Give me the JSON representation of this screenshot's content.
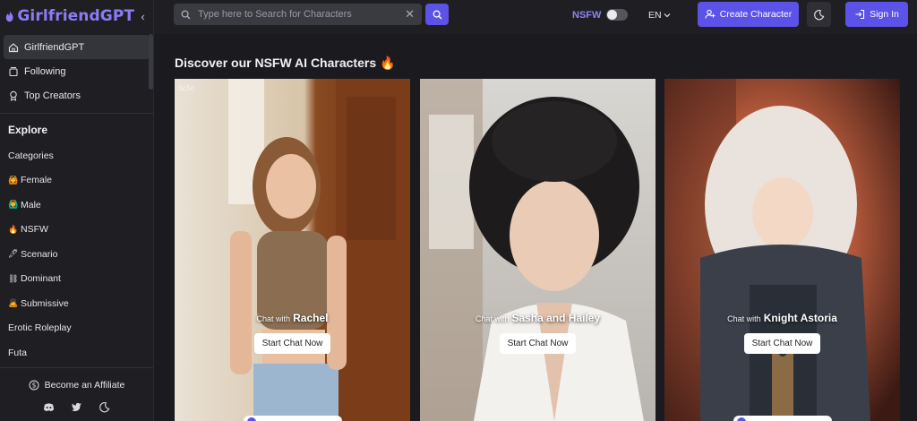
{
  "brand": {
    "name": "GirlfriendGPT",
    "collapse_glyph": "‹"
  },
  "sidebar": {
    "primary": [
      {
        "label": "GirlfriendGPT",
        "icon": "home-icon",
        "active": true
      },
      {
        "label": "Following",
        "icon": "following-icon",
        "active": false
      },
      {
        "label": "Top Creators",
        "icon": "award-icon",
        "active": false
      }
    ],
    "explore_title": "Explore",
    "explore": [
      {
        "label": "Categories",
        "emoji": ""
      },
      {
        "label": "Female",
        "emoji": "🙆"
      },
      {
        "label": "Male",
        "emoji": "🙆‍♂"
      },
      {
        "label": "NSFW",
        "emoji": "🔥"
      },
      {
        "label": "Scenario",
        "emoji": "🖊"
      },
      {
        "label": "Dominant",
        "emoji": "⛓"
      },
      {
        "label": "Submissive",
        "emoji": "🙇"
      },
      {
        "label": "Erotic Roleplay",
        "emoji": ""
      },
      {
        "label": "Futa",
        "emoji": ""
      }
    ],
    "affiliate_label": "Become an Affiliate"
  },
  "topbar": {
    "search_placeholder": "Type here to Search for Characters",
    "nsfw_label": "NSFW",
    "lang_label": "EN",
    "create_label": "Create Character",
    "signin_label": "Sign In"
  },
  "main": {
    "title": "Discover our NSFW AI Characters 🔥",
    "cards": [
      {
        "pre": "Chat with",
        "name": "Rachel",
        "button": "Start Chat Now",
        "watermark": "Sc5o"
      },
      {
        "pre": "Chat with",
        "name": "Sasha and Hailey",
        "button": "Start Chat Now",
        "watermark": ""
      },
      {
        "pre": "Chat with",
        "name": "Knight Astoria",
        "button": "Start Chat Now",
        "watermark": ""
      }
    ]
  },
  "colors": {
    "accent": "#5b52e8",
    "brand": "#8b7cf6",
    "background": "#1b1b1f",
    "sidebar": "#1f1f23"
  }
}
